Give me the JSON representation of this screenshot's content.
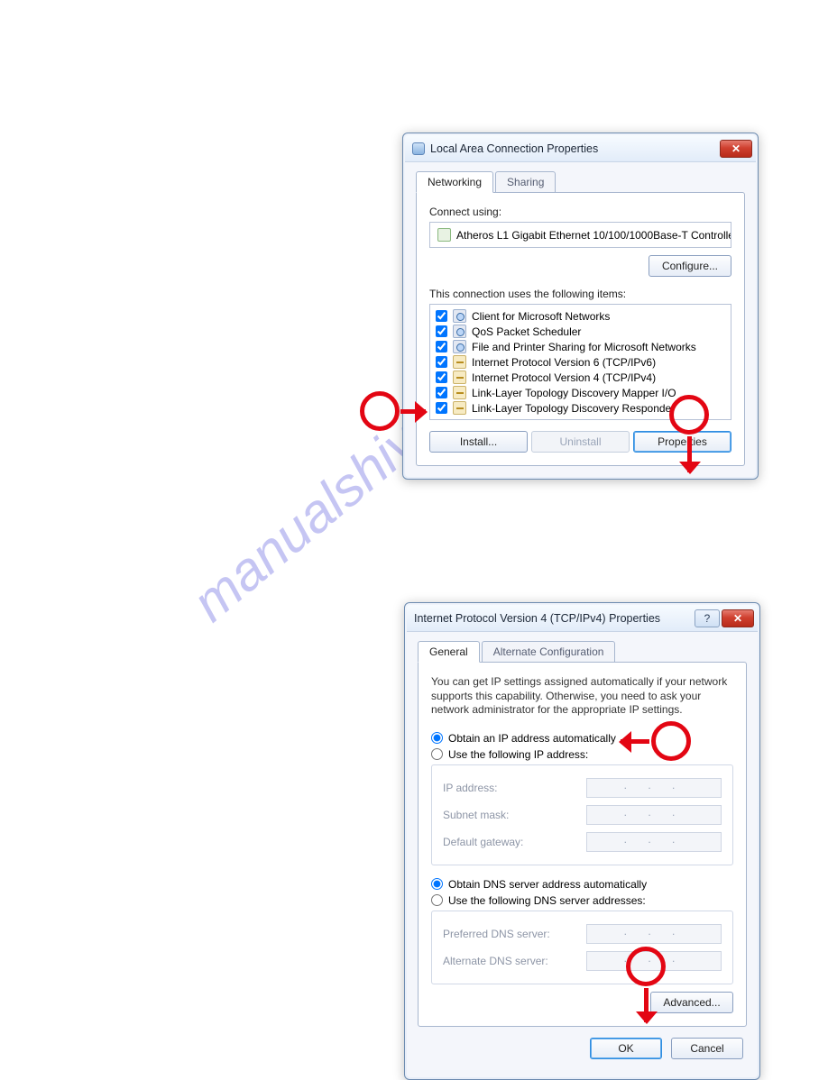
{
  "dialog1": {
    "title": "Local Area Connection Properties",
    "tabs": [
      "Networking",
      "Sharing"
    ],
    "connect_using_label": "Connect using:",
    "adapter": "Atheros L1 Gigabit Ethernet 10/100/1000Base-T Controlle",
    "configure_btn": "Configure...",
    "uses_label": "This connection uses the following items:",
    "items": [
      "Client for Microsoft Networks",
      "QoS Packet Scheduler",
      "File and Printer Sharing for Microsoft Networks",
      "Internet Protocol Version 6 (TCP/IPv6)",
      "Internet Protocol Version 4 (TCP/IPv4)",
      "Link-Layer Topology Discovery Mapper I/O",
      "Link-Layer Topology Discovery Responder"
    ],
    "install_btn": "Install...",
    "uninstall_btn": "Uninstall",
    "properties_btn": "Properties"
  },
  "dialog2": {
    "title": "Internet Protocol Version 4 (TCP/IPv4) Properties",
    "tabs": [
      "General",
      "Alternate Configuration"
    ],
    "desc": "You can get IP settings assigned automatically if your network supports this capability. Otherwise, you need to ask your network administrator for the appropriate IP settings.",
    "radio_auto_ip": "Obtain an IP address automatically",
    "radio_manual_ip": "Use the following IP address:",
    "ip_label": "IP address:",
    "mask_label": "Subnet mask:",
    "gw_label": "Default gateway:",
    "radio_auto_dns": "Obtain DNS server address automatically",
    "radio_manual_dns": "Use the following DNS server addresses:",
    "dns1_label": "Preferred DNS server:",
    "dns2_label": "Alternate DNS server:",
    "advanced_btn": "Advanced...",
    "ok_btn": "OK",
    "cancel_btn": "Cancel",
    "dot_value": ".     .    ."
  },
  "watermark": "manualshive.com"
}
